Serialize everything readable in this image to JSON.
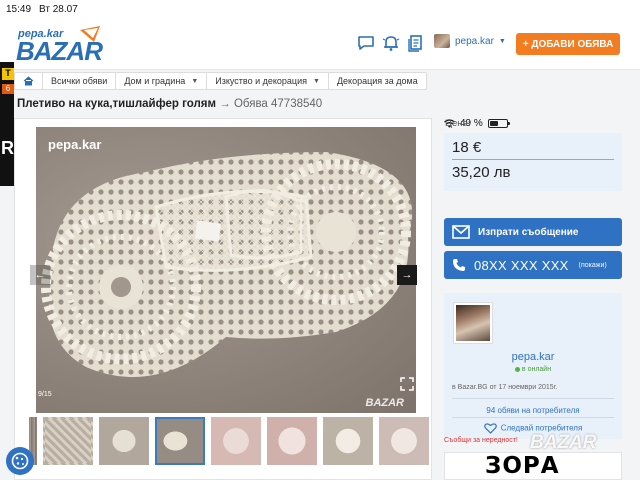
{
  "status": {
    "time": "15:49",
    "date": "Вт 28.07",
    "battery": "49 %",
    "battery_level": 0.49
  },
  "header": {
    "logo_top": "pepa.kar",
    "logo_main": "BAZAR",
    "username": "pepa.kar",
    "add_button": "+ ДОБАВИ ОБЯВА",
    "icons": [
      "chat-icon",
      "bell-icon",
      "documents-icon"
    ]
  },
  "left_ad": {
    "line1": "T",
    "line2": "6",
    "line3": "R"
  },
  "breadcrumb": [
    {
      "label": "",
      "icon": "home-icon"
    },
    {
      "label": "Всички обяви"
    },
    {
      "label": "Дом и градина",
      "dropdown": true
    },
    {
      "label": "Изкуство и декорация",
      "dropdown": true
    },
    {
      "label": "Декорация за дома"
    }
  ],
  "listing": {
    "title": "Плетиво на кука,тишлайфер голям",
    "arrow": "→",
    "ad_number": "Обява 47738540"
  },
  "gallery": {
    "watermark": "pepa.kar",
    "counter": "9/15",
    "watermark_brand": "BAZAR",
    "active_thumb": 2,
    "thumb_count": 8
  },
  "price": {
    "label": "Цена:",
    "bgn": "18 €",
    "alt": "35,20 лв"
  },
  "buttons": {
    "send_message": "Изпрати съобщение",
    "phone": "08XX XXX XXX",
    "phone_show": "(покажи)"
  },
  "seller": {
    "name": "pepa.kar",
    "status": "в онлайн",
    "since": "в Bazar.BG от 17 ноември 2015г.",
    "ads_link": "94 обяви на потребителя",
    "follow": "Следвай потребителя"
  },
  "report": "Съобщи за нередност!",
  "banner": {
    "text": "ЗОРА",
    "brand": "BAZAR"
  },
  "colors": {
    "accent": "#2f72c4",
    "orange": "#f47c20",
    "light_blue": "#e8f0fa"
  }
}
